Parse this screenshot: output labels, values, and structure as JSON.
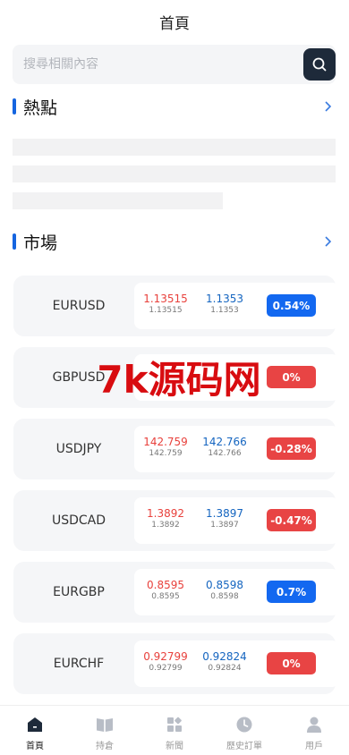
{
  "header": {
    "title": "首頁"
  },
  "search": {
    "placeholder": "搜尋相關內容",
    "icon": "search-icon"
  },
  "hot": {
    "title": "熱點",
    "more_icon": "chevron-right-icon"
  },
  "market": {
    "title": "市場",
    "more_icon": "chevron-right-icon",
    "items": [
      {
        "symbol": "EURUSD",
        "bid": "1.13515",
        "bid_sub": "1.13515",
        "ask": "1.1353",
        "ask_sub": "1.1353",
        "change": "0.54%",
        "direction": "up"
      },
      {
        "symbol": "GBPUSD",
        "bid": "",
        "bid_sub": "",
        "ask": "",
        "ask_sub": "",
        "change": "0%",
        "direction": "down"
      },
      {
        "symbol": "USDJPY",
        "bid": "142.759",
        "bid_sub": "142.759",
        "ask": "142.766",
        "ask_sub": "142.766",
        "change": "-0.28%",
        "direction": "down"
      },
      {
        "symbol": "USDCAD",
        "bid": "1.3892",
        "bid_sub": "1.3892",
        "ask": "1.3897",
        "ask_sub": "1.3897",
        "change": "-0.47%",
        "direction": "down"
      },
      {
        "symbol": "EURGBP",
        "bid": "0.8595",
        "bid_sub": "0.8595",
        "ask": "0.8598",
        "ask_sub": "0.8598",
        "change": "0.7%",
        "direction": "up"
      },
      {
        "symbol": "EURCHF",
        "bid": "0.92799",
        "bid_sub": "0.92799",
        "ask": "0.92824",
        "ask_sub": "0.92824",
        "change": "0%",
        "direction": "down"
      }
    ]
  },
  "watermark": {
    "text": "7k源码网"
  },
  "tabbar": {
    "items": [
      {
        "label": "首頁",
        "icon": "home-icon",
        "active": true
      },
      {
        "label": "持倉",
        "icon": "book-icon",
        "active": false
      },
      {
        "label": "新聞",
        "icon": "apps-icon",
        "active": false
      },
      {
        "label": "歷史訂單",
        "icon": "clock-icon",
        "active": false
      },
      {
        "label": "用戶",
        "icon": "user-icon",
        "active": false
      }
    ]
  },
  "colors": {
    "accent": "#1565e0",
    "bid_red": "#e8413c",
    "ask_blue": "#1565c0",
    "up_badge": "#1368f0",
    "down_badge": "#e84444",
    "search_button": "#1e2a3a"
  }
}
